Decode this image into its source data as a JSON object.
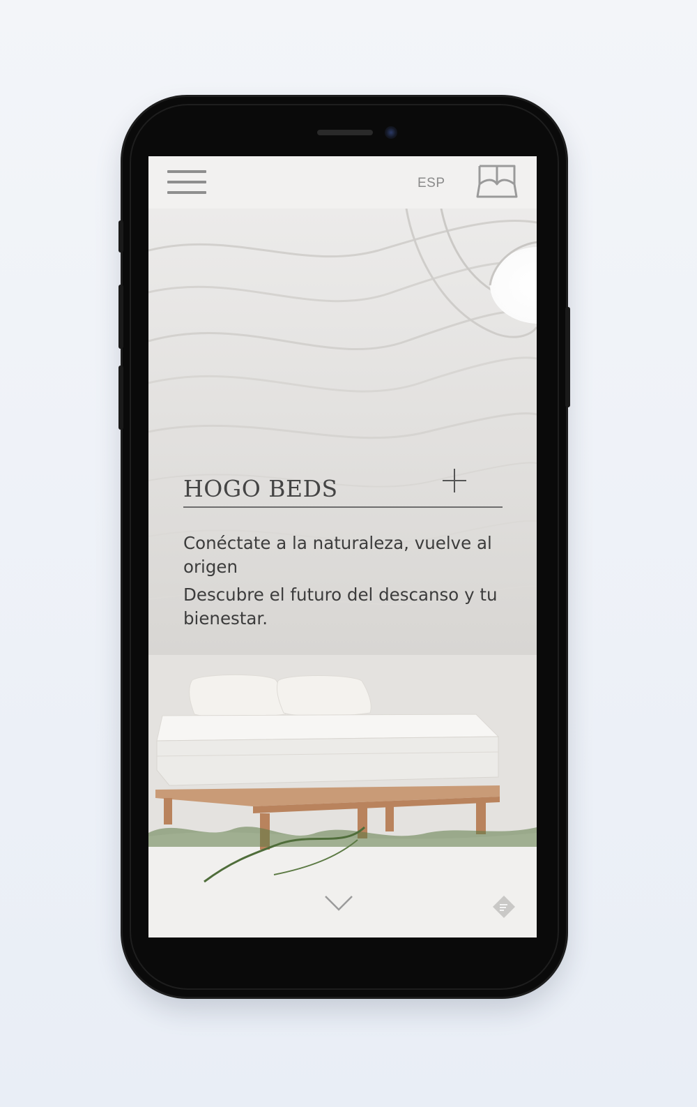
{
  "header": {
    "language": "ESP",
    "menu_icon": "hamburger-menu-icon",
    "logo_icon": "bed-logo-icon"
  },
  "hero": {
    "title": "HOGO BEDS",
    "expand_icon": "plus-icon",
    "line1": "Conéctate a la naturaleza, vuelve al origen",
    "line2": "Descubre el futuro del descanso y tu bienestar.",
    "scroll_icon": "chevron-down-icon",
    "chat_icon": "chat-badge-icon"
  },
  "colors": {
    "frame": "#0a0a0a",
    "topbar": "#f2f1f0",
    "text": "#3c3c3c",
    "muted": "#8a8a8a"
  }
}
